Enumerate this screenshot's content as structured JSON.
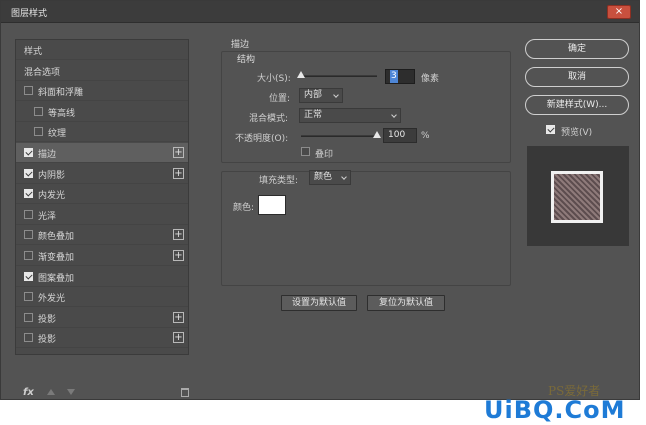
{
  "window": {
    "title": "图层样式",
    "close_label": "×"
  },
  "style_list": {
    "items": [
      {
        "label": "样式",
        "checkbox": false,
        "checked": false,
        "plus": false,
        "selected": false,
        "indent": 0
      },
      {
        "label": "混合选项",
        "checkbox": false,
        "checked": false,
        "plus": false,
        "selected": false,
        "indent": 0
      },
      {
        "label": "斜面和浮雕",
        "checkbox": true,
        "checked": false,
        "plus": false,
        "selected": false,
        "indent": 0
      },
      {
        "label": "等高线",
        "checkbox": true,
        "checked": false,
        "plus": false,
        "selected": false,
        "indent": 1
      },
      {
        "label": "纹理",
        "checkbox": true,
        "checked": false,
        "plus": false,
        "selected": false,
        "indent": 1
      },
      {
        "label": "描边",
        "checkbox": true,
        "checked": true,
        "plus": true,
        "selected": true,
        "indent": 0
      },
      {
        "label": "内阴影",
        "checkbox": true,
        "checked": true,
        "plus": true,
        "selected": false,
        "indent": 0
      },
      {
        "label": "内发光",
        "checkbox": true,
        "checked": true,
        "plus": false,
        "selected": false,
        "indent": 0
      },
      {
        "label": "光泽",
        "checkbox": true,
        "checked": false,
        "plus": false,
        "selected": false,
        "indent": 0
      },
      {
        "label": "颜色叠加",
        "checkbox": true,
        "checked": false,
        "plus": true,
        "selected": false,
        "indent": 0
      },
      {
        "label": "渐变叠加",
        "checkbox": true,
        "checked": false,
        "plus": true,
        "selected": false,
        "indent": 0
      },
      {
        "label": "图案叠加",
        "checkbox": true,
        "checked": true,
        "plus": false,
        "selected": false,
        "indent": 0
      },
      {
        "label": "外发光",
        "checkbox": true,
        "checked": false,
        "plus": false,
        "selected": false,
        "indent": 0
      },
      {
        "label": "投影",
        "checkbox": true,
        "checked": false,
        "plus": true,
        "selected": false,
        "indent": 0
      },
      {
        "label": "投影",
        "checkbox": true,
        "checked": false,
        "plus": true,
        "selected": false,
        "indent": 0
      }
    ],
    "footer": {
      "fx_label": "fx"
    }
  },
  "stroke": {
    "section_title": "描边",
    "structure_title": "结构",
    "size_label": "大小(S):",
    "size_value": "3",
    "size_unit": "像素",
    "position_label": "位置:",
    "position_value": "内部",
    "blend_mode_label": "混合模式:",
    "blend_mode_value": "正常",
    "opacity_label": "不透明度(O):",
    "opacity_value": "100",
    "opacity_unit": "%",
    "overprint_label": "叠印",
    "fill_type_label": "填充类型:",
    "fill_type_value": "颜色",
    "color_label": "颜色:",
    "color_value": "#ffffff",
    "make_default_label": "设置为默认值",
    "reset_default_label": "复位为默认值"
  },
  "actions": {
    "ok_label": "确定",
    "cancel_label": "取消",
    "new_style_label": "新建样式(W)...",
    "preview_label": "预览(V)",
    "preview_checked": true
  },
  "watermark": {
    "text": "UiBQ.CoM",
    "sub": "PS爱好者"
  }
}
